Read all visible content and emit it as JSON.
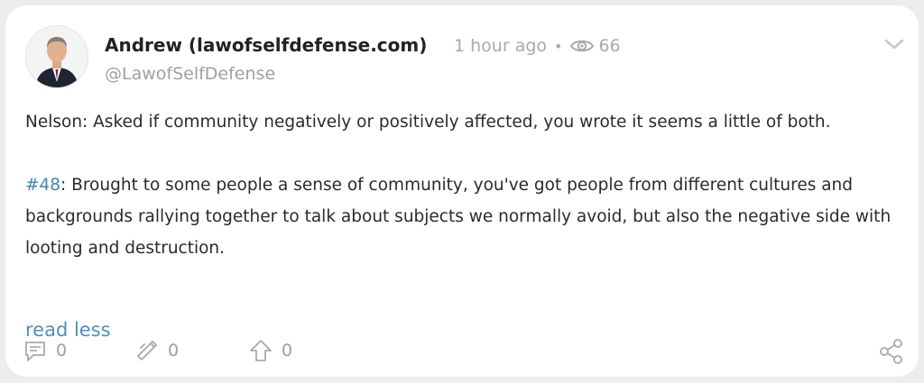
{
  "post": {
    "author_name": "Andrew (lawofselfdefense.com)",
    "time_ago": "1 hour ago",
    "views": "66",
    "handle": "@LawofSelfDefense",
    "body": {
      "para1": "Nelson: Asked if community negatively or positively affected, you wrote it seems a little of both.",
      "hashtag": "#48",
      "para2_rest": ": Brought to some people a sense of community, you've got people from different cultures and backgrounds rallying together to talk about subjects we normally avoid, but also the negative side with looting and destruction."
    },
    "read_less_label": "read less"
  },
  "actions": {
    "comments": "0",
    "reposts": "0",
    "upvotes": "0"
  },
  "icons": {
    "views": "eye-icon",
    "menu": "chevron-down-icon",
    "comment": "comment-icon",
    "repost": "repost-icon",
    "upvote": "arrow-up-icon",
    "share": "share-icon"
  },
  "colors": {
    "background": "#ededed",
    "card": "#ffffff",
    "hashtag": "#3d86b8",
    "link": "#4f8fbd",
    "muted": "#a9a9a9"
  }
}
